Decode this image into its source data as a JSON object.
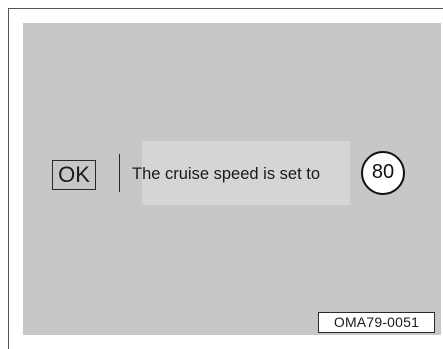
{
  "display": {
    "ok_label": "OK",
    "message": "The cruise speed is set to",
    "speed_value": "80"
  },
  "figure": {
    "code": "OMA79-0051"
  },
  "colors": {
    "screen_background": "#c6c7c9",
    "message_panel": "#d4d5d7",
    "text": "#1a1a1a"
  }
}
